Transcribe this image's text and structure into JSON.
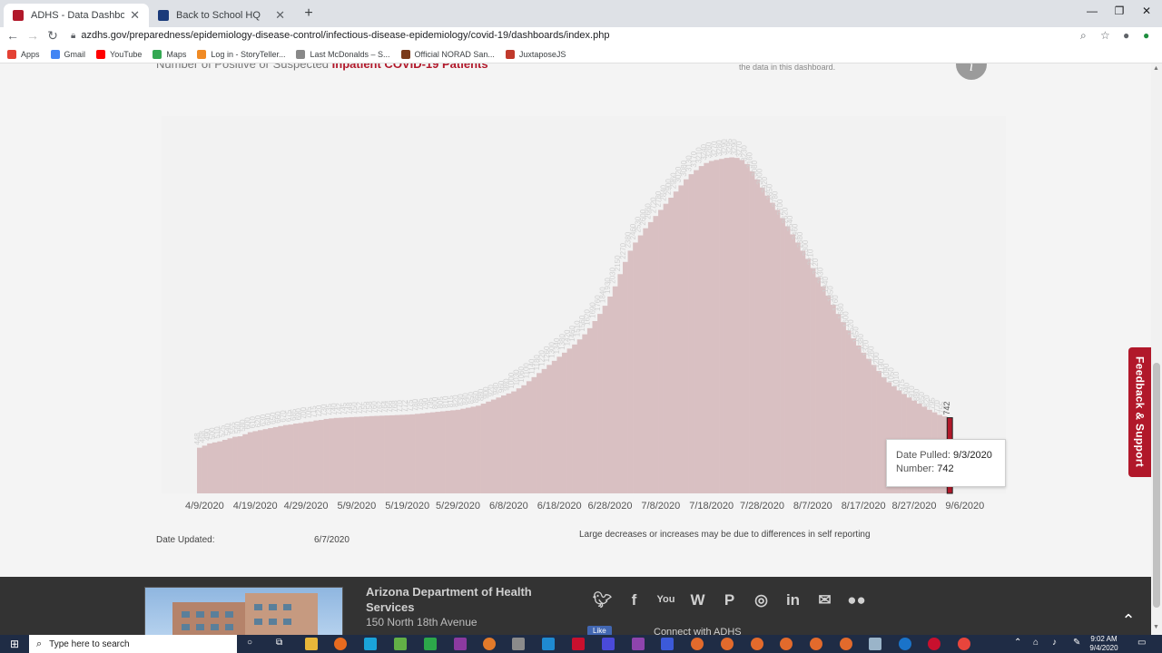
{
  "browser": {
    "tabs": [
      {
        "title": "ADHS - Data Dashboard",
        "active": true,
        "favicon_color": "#b1182a"
      },
      {
        "title": "Back to School HQ",
        "active": false,
        "favicon_color": "#1a3a7a"
      }
    ],
    "url": "azdhs.gov/preparedness/epidemiology-disease-control/infectious-disease-epidemiology/covid-19/dashboards/index.php",
    "bookmarks": [
      {
        "label": "Apps",
        "color": "#e44134"
      },
      {
        "label": "Gmail",
        "color": "#4285f4"
      },
      {
        "label": "YouTube",
        "color": "#ff0000"
      },
      {
        "label": "Maps",
        "color": "#34a853"
      },
      {
        "label": "Log in - StoryTeller...",
        "color": "#f08a24"
      },
      {
        "label": "Last McDonalds – S...",
        "color": "#888888"
      },
      {
        "label": "Official NORAD San...",
        "color": "#7a3a1a"
      },
      {
        "label": "JuxtaposeJS",
        "color": "#c0392b"
      }
    ]
  },
  "page": {
    "cut_title_prefix": "Number of Positive or Suspected ",
    "cut_title_highlight": "Inpatient COVID-19 Patients",
    "cut_note": "the data in this dashboard.",
    "info_icon": "i",
    "tooltip": {
      "date_label": "Date Pulled:",
      "date_value": "9/3/2020",
      "number_label": "Number:",
      "number_value": "742"
    },
    "date_updated_label": "Date Updated:",
    "date_updated_value": "6/7/2020",
    "disclaimer": "Large decreases or increases may be due to differences in self reporting",
    "feedback_label": "Feedback & Support"
  },
  "chart_data": {
    "type": "bar",
    "title": "",
    "xlabel": "",
    "ylabel": "",
    "x_tick_labels": [
      "4/9/2020",
      "4/19/2020",
      "4/29/2020",
      "5/9/2020",
      "5/19/2020",
      "5/29/2020",
      "6/8/2020",
      "6/18/2020",
      "6/28/2020",
      "7/8/2020",
      "7/18/2020",
      "7/28/2020",
      "8/7/2020",
      "8/17/2020",
      "8/27/2020",
      "9/6/2020"
    ],
    "start_date": "2020-04-08",
    "bar_color": "#d9c0c2",
    "highlight_color": "#b1182a",
    "highlight_index": 148,
    "highlight_label": "742",
    "ylim": [
      0,
      3700
    ],
    "values": [
      448,
      468,
      490,
      500,
      510,
      525,
      540,
      555,
      560,
      580,
      600,
      610,
      620,
      630,
      640,
      650,
      660,
      670,
      675,
      685,
      690,
      700,
      705,
      715,
      720,
      730,
      735,
      740,
      742,
      745,
      748,
      750,
      752,
      755,
      758,
      760,
      762,
      764,
      766,
      768,
      770,
      772,
      775,
      780,
      785,
      790,
      795,
      800,
      805,
      810,
      815,
      820,
      830,
      840,
      850,
      860,
      880,
      900,
      920,
      940,
      960,
      980,
      1000,
      1030,
      1060,
      1100,
      1140,
      1180,
      1220,
      1260,
      1300,
      1340,
      1380,
      1420,
      1460,
      1510,
      1560,
      1620,
      1690,
      1760,
      1840,
      1930,
      2030,
      2150,
      2270,
      2380,
      2460,
      2530,
      2600,
      2660,
      2720,
      2780,
      2840,
      2900,
      2960,
      3020,
      3080,
      3130,
      3170,
      3210,
      3240,
      3260,
      3270,
      3280,
      3290,
      3295,
      3290,
      3270,
      3230,
      3160,
      3080,
      3000,
      2920,
      2850,
      2780,
      2700,
      2620,
      2540,
      2460,
      2380,
      2300,
      2210,
      2120,
      2030,
      1940,
      1850,
      1760,
      1680,
      1600,
      1520,
      1450,
      1380,
      1320,
      1260,
      1200,
      1140,
      1090,
      1050,
      1010,
      975,
      940,
      910,
      880,
      850,
      820,
      795,
      770,
      755,
      742
    ]
  },
  "footer": {
    "org_name": "Arizona Department of Health Services",
    "address": "150 North 18th Avenue",
    "socials": [
      "twitter-icon",
      "facebook-icon",
      "youtube-icon",
      "wordpress-icon",
      "pinterest-icon",
      "instagram-icon",
      "linkedin-icon",
      "email-icon",
      "flickr-icon"
    ],
    "like_label": "Like",
    "connect_label": "Connect with ADHS"
  },
  "taskbar": {
    "search_placeholder": "Type here to search",
    "time": "9:02 AM",
    "date": "9/4/2020"
  }
}
